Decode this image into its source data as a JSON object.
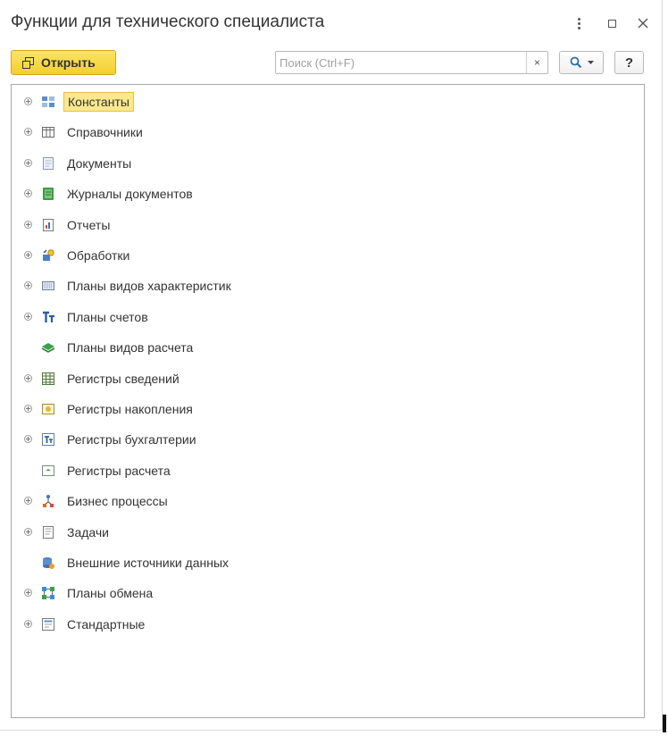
{
  "window": {
    "title": "Функции для технического специалиста"
  },
  "toolbar": {
    "open_label": "Открыть",
    "search_placeholder": "Поиск (Ctrl+F)",
    "search_value": "",
    "clear_label": "×",
    "help_label": "?"
  },
  "tree": {
    "items": [
      {
        "label": "Константы",
        "icon": "constants-icon",
        "expandable": true,
        "selected": true
      },
      {
        "label": "Справочники",
        "icon": "catalogs-icon",
        "expandable": true
      },
      {
        "label": "Документы",
        "icon": "documents-icon",
        "expandable": true
      },
      {
        "label": "Журналы документов",
        "icon": "document-journals-icon",
        "expandable": true
      },
      {
        "label": "Отчеты",
        "icon": "reports-icon",
        "expandable": true
      },
      {
        "label": "Обработки",
        "icon": "data-processors-icon",
        "expandable": true
      },
      {
        "label": "Планы видов характеристик",
        "icon": "characteristic-types-icon",
        "expandable": true
      },
      {
        "label": "Планы счетов",
        "icon": "chart-of-accounts-icon",
        "expandable": true
      },
      {
        "label": "Планы видов расчета",
        "icon": "calculation-types-icon",
        "expandable": false
      },
      {
        "label": "Регистры сведений",
        "icon": "information-registers-icon",
        "expandable": true
      },
      {
        "label": "Регистры накопления",
        "icon": "accumulation-registers-icon",
        "expandable": true
      },
      {
        "label": "Регистры бухгалтерии",
        "icon": "accounting-registers-icon",
        "expandable": true
      },
      {
        "label": "Регистры расчета",
        "icon": "calculation-registers-icon",
        "expandable": false
      },
      {
        "label": "Бизнес процессы",
        "icon": "business-processes-icon",
        "expandable": true
      },
      {
        "label": "Задачи",
        "icon": "tasks-icon",
        "expandable": true
      },
      {
        "label": "Внешние источники данных",
        "icon": "external-data-sources-icon",
        "expandable": false
      },
      {
        "label": "Планы обмена",
        "icon": "exchange-plans-icon",
        "expandable": true
      },
      {
        "label": "Стандартные",
        "icon": "standard-icon",
        "expandable": true
      }
    ]
  },
  "colors": {
    "accent_yellow": "#f3cf2f",
    "selection": "#fbe88d",
    "border": "#a9a9a9"
  }
}
